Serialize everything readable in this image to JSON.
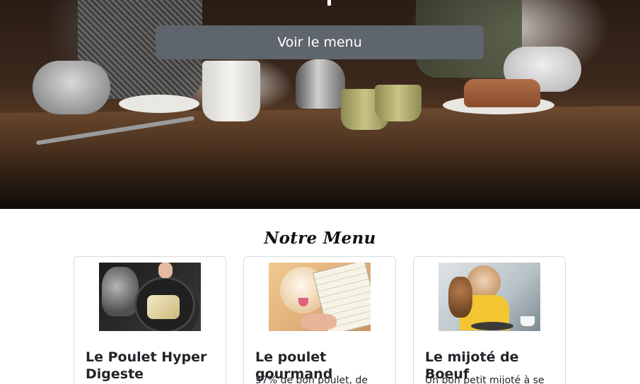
{
  "hero": {
    "button_label": "Voir le menu"
  },
  "menu_section": {
    "title": "Notre Menu",
    "cards": [
      {
        "title": "Le Poulet Hyper Digeste",
        "text": ""
      },
      {
        "title": "Le poulet gourmand",
        "text": "57% de bon poulet, de"
      },
      {
        "title": "Le mijoté de Boeuf",
        "text": "Un bon petit mijoté à se"
      }
    ]
  },
  "colors": {
    "button_bg": "#5f656c",
    "card_border": "#d8dadd",
    "text": "#212529"
  }
}
